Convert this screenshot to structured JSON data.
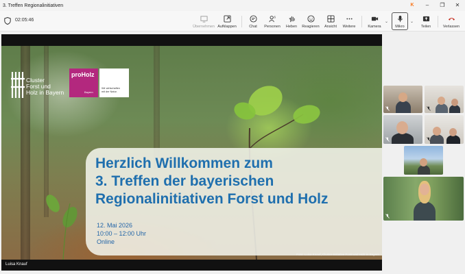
{
  "window": {
    "title": "3. Treffen Regionalinitiativen",
    "controls": [
      "minimize",
      "restore",
      "maximize",
      "close"
    ]
  },
  "toolbar": {
    "timer": "02:05:46",
    "buttons": [
      {
        "id": "uebernehmen",
        "label": "Übernehmen",
        "icon": "share-screen-icon",
        "disabled": true
      },
      {
        "id": "aufklappen",
        "label": "Aufklappen",
        "icon": "popout-icon"
      },
      {
        "id": "chat",
        "label": "Chat",
        "icon": "chat-icon"
      },
      {
        "id": "personen",
        "label": "Personen",
        "icon": "people-icon",
        "badge": "6"
      },
      {
        "id": "heben",
        "label": "Heben",
        "icon": "raise-hand-icon"
      },
      {
        "id": "reagieren",
        "label": "Reagieren",
        "icon": "smiley-icon"
      },
      {
        "id": "ansicht",
        "label": "Ansicht",
        "icon": "grid-view-icon"
      },
      {
        "id": "weitere",
        "label": "Weitere",
        "icon": "more-icon"
      },
      {
        "id": "kamera",
        "label": "Kamera",
        "icon": "camera-icon"
      },
      {
        "id": "mikro",
        "label": "Mikro",
        "icon": "microphone-icon"
      },
      {
        "id": "teilen",
        "label": "Teilen",
        "icon": "share-icon"
      },
      {
        "id": "verlassen",
        "label": "Verlassen",
        "icon": "hangup-icon",
        "color": "#c42b1c"
      }
    ]
  },
  "slide": {
    "logo_text": "Cluster\nForst und\nHolz in Bayern",
    "partner_brand": "proHolz",
    "partner_sub": "Bayern",
    "partner_tagline": "Wir wirtschaften\nmit der Natur.",
    "headline_lines": [
      "Herzlich Willkommen zum",
      "3. Treffen der bayerischen",
      "Regionalinitiativen Forst und Holz"
    ],
    "date": "12. Mai 2026",
    "time": "10:00 – 12:00 Uhr",
    "mode": "Online",
    "credit": "Foto: Luisa Knauf, Cluster-Initiative Forst und Holz in Bayern",
    "headline_color": "#1f6fae"
  },
  "presenter_name": "Luisa Knauf",
  "gallery_count": 6
}
